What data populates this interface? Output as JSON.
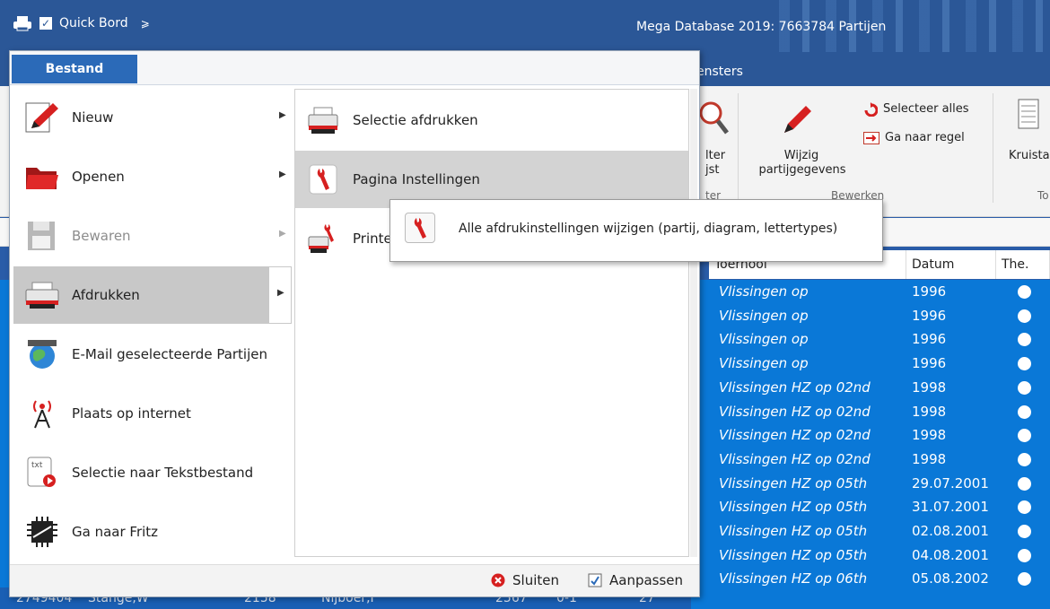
{
  "titlebar": {
    "quick_label": "Quick Bord",
    "quick_dropdown": "⩾",
    "app_title": "Mega Database 2019:  7663784 Partijen"
  },
  "ribbon": {
    "tab_vensters": "ensters",
    "filter_partial1": "lter",
    "filter_partial2": "jst",
    "filter_partial3": "ter",
    "wijzig_line1": "Wijzig",
    "wijzig_line2": "partijgegevens",
    "selecteer_alles": "Selecteer alles",
    "ga_naar_regel": "Ga naar regel",
    "group_bewerken": "Bewerken",
    "kruistabel_partial": "Kruista",
    "group_to_partial": "To"
  },
  "grid": {
    "col_toernooi": "Toernooi",
    "col_datum": "Datum",
    "col_the": "The.",
    "rows": [
      {
        "toernooi": "Vlissingen op",
        "datum": "1996"
      },
      {
        "toernooi": "Vlissingen op",
        "datum": "1996"
      },
      {
        "toernooi": "Vlissingen op",
        "datum": "1996"
      },
      {
        "toernooi": "Vlissingen op",
        "datum": "1996"
      },
      {
        "toernooi": "Vlissingen HZ op 02nd",
        "datum": "1998"
      },
      {
        "toernooi": "Vlissingen HZ op 02nd",
        "datum": "1998"
      },
      {
        "toernooi": "Vlissingen HZ op 02nd",
        "datum": "1998"
      },
      {
        "toernooi": "Vlissingen HZ op 02nd",
        "datum": "1998"
      },
      {
        "toernooi": "Vlissingen HZ op 05th",
        "datum": "29.07.2001"
      },
      {
        "toernooi": "Vlissingen HZ op 05th",
        "datum": "31.07.2001"
      },
      {
        "toernooi": "Vlissingen HZ op 05th",
        "datum": "02.08.2001"
      },
      {
        "toernooi": "Vlissingen HZ op 05th",
        "datum": "04.08.2001"
      },
      {
        "toernooi": "Vlissingen HZ op 06th",
        "datum": "05.08.2002"
      }
    ],
    "bottom_row": {
      "id": "2749404",
      "player1": "Stange,W",
      "elo1": "2158",
      "player2": "Nijboer,F",
      "elo2": "2567",
      "result": "0-1",
      "moves": "27"
    }
  },
  "menu": {
    "tab_label": "Bestand",
    "items": [
      {
        "label": "Nieuw",
        "has_sub": true,
        "icon": "pencil-icon"
      },
      {
        "label": "Openen",
        "has_sub": true,
        "icon": "folder-icon"
      },
      {
        "label": "Bewaren",
        "has_sub": true,
        "icon": "floppy-disk-icon",
        "disabled": true
      },
      {
        "label": "Afdrukken",
        "has_sub": true,
        "icon": "printer-icon",
        "selected": true
      },
      {
        "label": "E-Mail geselecteerde Partijen",
        "has_sub": false,
        "icon": "globe-icon"
      },
      {
        "label": "Plaats op internet",
        "has_sub": false,
        "icon": "antenna-icon"
      },
      {
        "label": "Selectie naar Tekstbestand",
        "has_sub": false,
        "icon": "text-file-icon"
      },
      {
        "label": "Ga naar Fritz",
        "has_sub": false,
        "icon": "chip-icon"
      }
    ],
    "sub_items": [
      {
        "label": "Selectie afdrukken",
        "icon": "printer-icon"
      },
      {
        "label": "Pagina Instellingen",
        "icon": "wrench-icon",
        "selected": true
      },
      {
        "label": "Printe",
        "icon": "printer-wrench-icon"
      }
    ],
    "footer": {
      "close_label": "Sluiten",
      "customize_label": "Aanpassen"
    }
  },
  "tooltip": {
    "text": "Alle afdrukinstellingen wijzigen (partij, diagram, lettertypes)"
  },
  "colors": {
    "title_blue": "#2b5797",
    "tab_blue": "#2b6ab8",
    "selection_blue": "#0a78d7",
    "menu_selected": "#c8c8c8"
  }
}
